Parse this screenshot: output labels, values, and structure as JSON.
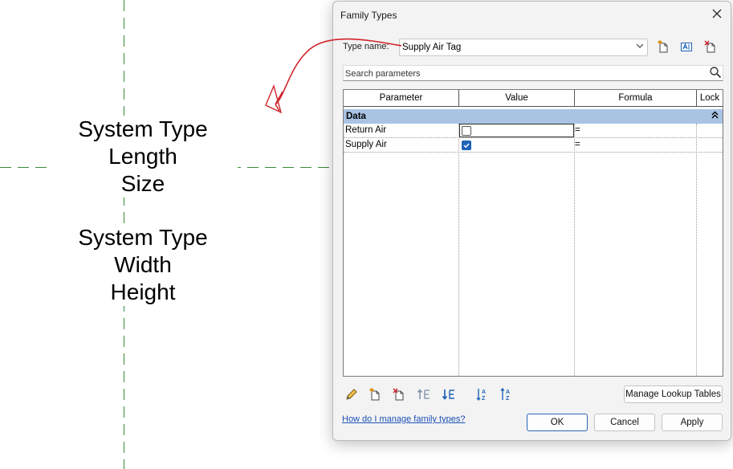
{
  "canvas": {
    "label_block_1": [
      "System Type",
      "Length",
      "Size"
    ],
    "label_block_2": [
      "System Type",
      "Width",
      "Height"
    ]
  },
  "dialog": {
    "title": "Family Types",
    "type_name_label": "Type name:",
    "type_name_value": "Supply Air Tag",
    "search_placeholder": "Search parameters",
    "columns": [
      "Parameter",
      "Value",
      "Formula",
      "Lock"
    ],
    "group": "Data",
    "rows": [
      {
        "parameter": "Return Air",
        "checked": false,
        "formula": "="
      },
      {
        "parameter": "Supply Air",
        "checked": true,
        "formula": "="
      }
    ],
    "manage_lookup_label": "Manage Lookup Tables",
    "help_link": "How do I manage family types?",
    "ok_label": "OK",
    "cancel_label": "Cancel",
    "apply_label": "Apply"
  },
  "colors": {
    "group_header": "#a9c4e3",
    "checkbox_on": "#1e63b8",
    "annotation": "#d0242b",
    "reference_line": "#3a8a3a",
    "link": "#1c51b8"
  }
}
